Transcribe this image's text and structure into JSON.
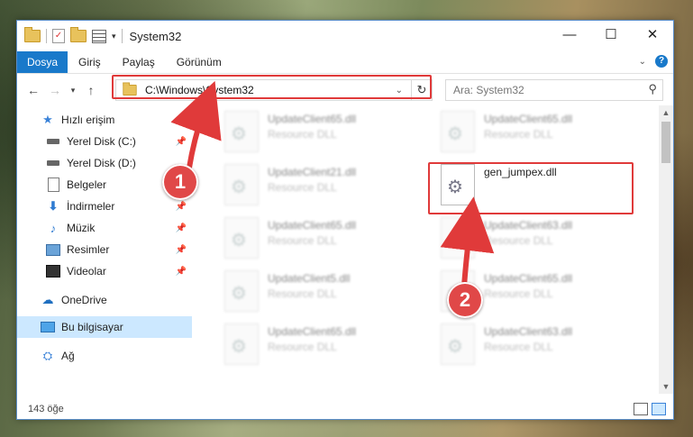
{
  "window": {
    "title": "System32",
    "controls": {
      "minimize": "—",
      "maximize": "☐",
      "close": "✕"
    }
  },
  "ribbon": {
    "file_tab": "Dosya",
    "tabs": [
      "Giriş",
      "Paylaş",
      "Görünüm"
    ]
  },
  "nav": {
    "address": "C:\\Windows\\System32",
    "search_placeholder": "Ara: System32"
  },
  "sidebar": {
    "quick_access": "Hızlı erişim",
    "items": [
      {
        "label": "Yerel Disk (C:)",
        "icon": "drive-icon",
        "pinned": true
      },
      {
        "label": "Yerel Disk (D:)",
        "icon": "drive-icon",
        "pinned": false
      },
      {
        "label": "Belgeler",
        "icon": "document-icon",
        "pinned": true
      },
      {
        "label": "İndirmeler",
        "icon": "download-icon",
        "pinned": true
      },
      {
        "label": "Müzik",
        "icon": "music-icon",
        "pinned": true
      },
      {
        "label": "Resimler",
        "icon": "pictures-icon",
        "pinned": true
      },
      {
        "label": "Videolar",
        "icon": "video-icon",
        "pinned": true
      }
    ],
    "onedrive": "OneDrive",
    "this_pc": "Bu bilgisayar",
    "network": "Ağ"
  },
  "files": {
    "col1": [
      {
        "name": "UpdateClient65.dll",
        "desc": "Resource DLL"
      },
      {
        "name": "UpdateClient21.dll",
        "desc": "Resource DLL"
      },
      {
        "name": "UpdateClient65.dll",
        "desc": "Resource DLL"
      },
      {
        "name": "UpdateClient5.dll",
        "desc": "Resource DLL"
      },
      {
        "name": "UpdateClient65.dll",
        "desc": "Resource DLL"
      }
    ],
    "col2": [
      {
        "name": "UpdateClient65.dll",
        "desc": "Resource DLL"
      },
      {
        "name": "gen_jumpex.dll",
        "desc": ""
      },
      {
        "name": "UpdateClient63.dll",
        "desc": "Resource DLL"
      },
      {
        "name": "UpdateClient65.dll",
        "desc": "Resource DLL"
      },
      {
        "name": "UpdateClient63.dll",
        "desc": "Resource DLL"
      }
    ]
  },
  "status": {
    "count": "143 öğe"
  },
  "annotations": {
    "step1": "1",
    "step2": "2",
    "color": "#e03a3a"
  }
}
